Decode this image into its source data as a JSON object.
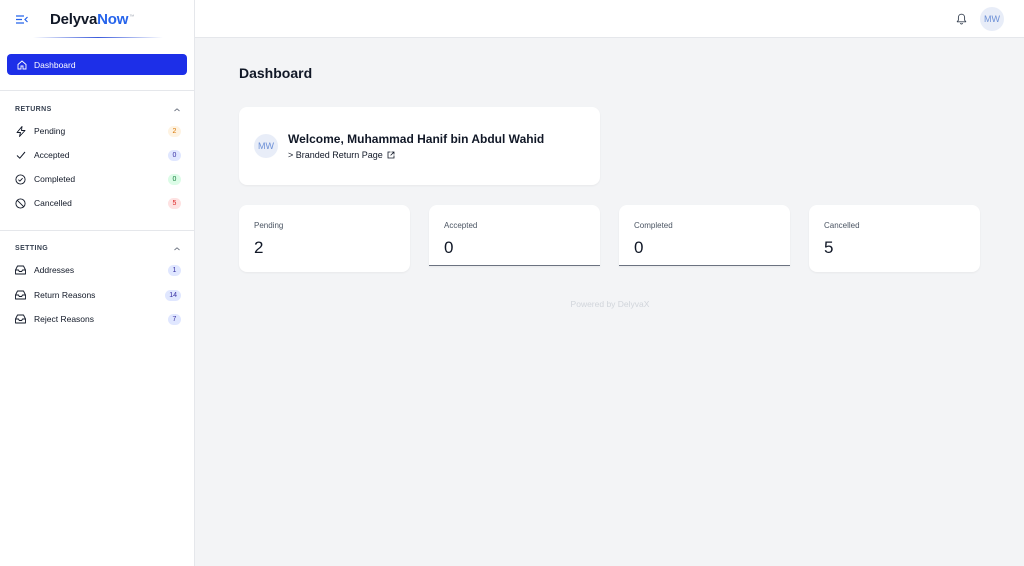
{
  "brand": {
    "name_part1": "Delyva",
    "name_part2": "Now",
    "sup": "™"
  },
  "sidebar": {
    "dashboard_label": "Dashboard",
    "returns": {
      "heading": "RETURNS",
      "items": [
        {
          "label": "Pending",
          "count": "2",
          "icon": "bolt-icon",
          "color": "orange"
        },
        {
          "label": "Accepted",
          "count": "0",
          "icon": "check-icon",
          "color": "indigo"
        },
        {
          "label": "Completed",
          "count": "0",
          "icon": "check-circle-icon",
          "color": "green"
        },
        {
          "label": "Cancelled",
          "count": "5",
          "icon": "ban-icon",
          "color": "red"
        }
      ]
    },
    "setting": {
      "heading": "SETTING",
      "items": [
        {
          "label": "Addresses",
          "count": "1",
          "icon": "tray-icon"
        },
        {
          "label": "Return Reasons",
          "count": "14",
          "icon": "tray-icon"
        },
        {
          "label": "Reject Reasons",
          "count": "7",
          "icon": "tray-icon"
        }
      ]
    }
  },
  "topbar": {
    "avatar_initials": "MW"
  },
  "main": {
    "title": "Dashboard",
    "welcome": {
      "initials": "MW",
      "text": "Welcome, Muhammad Hanif bin Abdul Wahid",
      "link": "> Branded Return Page"
    },
    "stats": [
      {
        "label": "Pending",
        "value": "2"
      },
      {
        "label": "Accepted",
        "value": "0"
      },
      {
        "label": "Completed",
        "value": "0"
      },
      {
        "label": "Cancelled",
        "value": "5"
      }
    ],
    "footer": "Powered by DelyvaX"
  },
  "colors": {
    "accent": "#1d2fe8",
    "brand_blue": "#2563eb"
  }
}
